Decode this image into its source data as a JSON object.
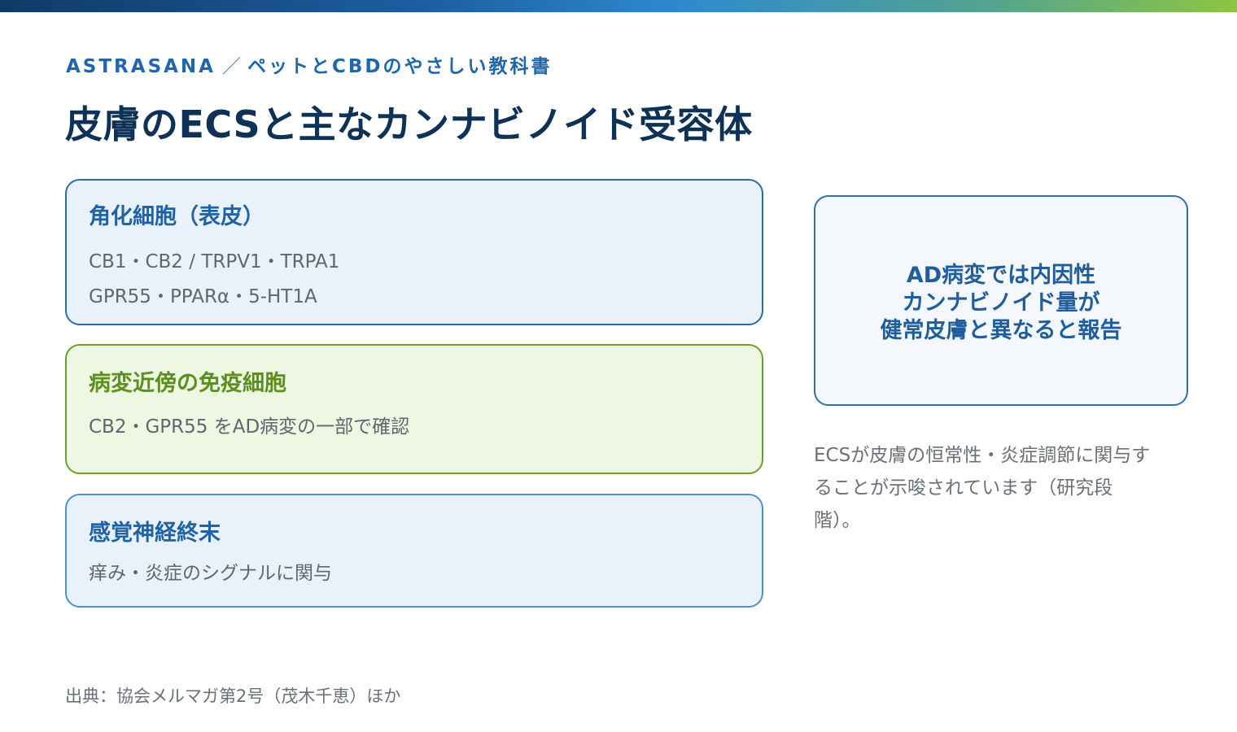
{
  "header": {
    "brand": "ASTRASANA",
    "separator": "／",
    "series": "ペットとCBDのやさしい教科書",
    "title": "皮膚のECSと主なカンナビノイド受容体"
  },
  "cards": [
    {
      "title": "角化細胞（表皮）",
      "lines": [
        "CB1・CB2 / TRPV1・TRPA1",
        "GPR55・PPARα・5-HT1A"
      ]
    },
    {
      "title": "病変近傍の免疫細胞",
      "lines": [
        "CB2・GPR55 をAD病変の一部で確認"
      ]
    },
    {
      "title": "感覚神経終末",
      "lines": [
        "痒み・炎症のシグナルに関与"
      ]
    }
  ],
  "callout": {
    "lines": [
      "AD病変では内因性",
      "カンナビノイド量が",
      "健常皮膚と異なると報告"
    ]
  },
  "note": {
    "lines": [
      "ECSが皮膚の恒常性・炎症調節に関与す",
      "ることが示唆されています（研究段",
      "階）。"
    ]
  },
  "footer": {
    "source": "出典：協会メルマガ第2号（茂木千恵）ほか"
  },
  "colors": {
    "title": "#0e3156",
    "accent_blue": "#1f62a5",
    "accent_green": "#5c8f1f",
    "card_blue_bg": "#e9f2fb",
    "card_green_bg": "#eef7e2"
  }
}
